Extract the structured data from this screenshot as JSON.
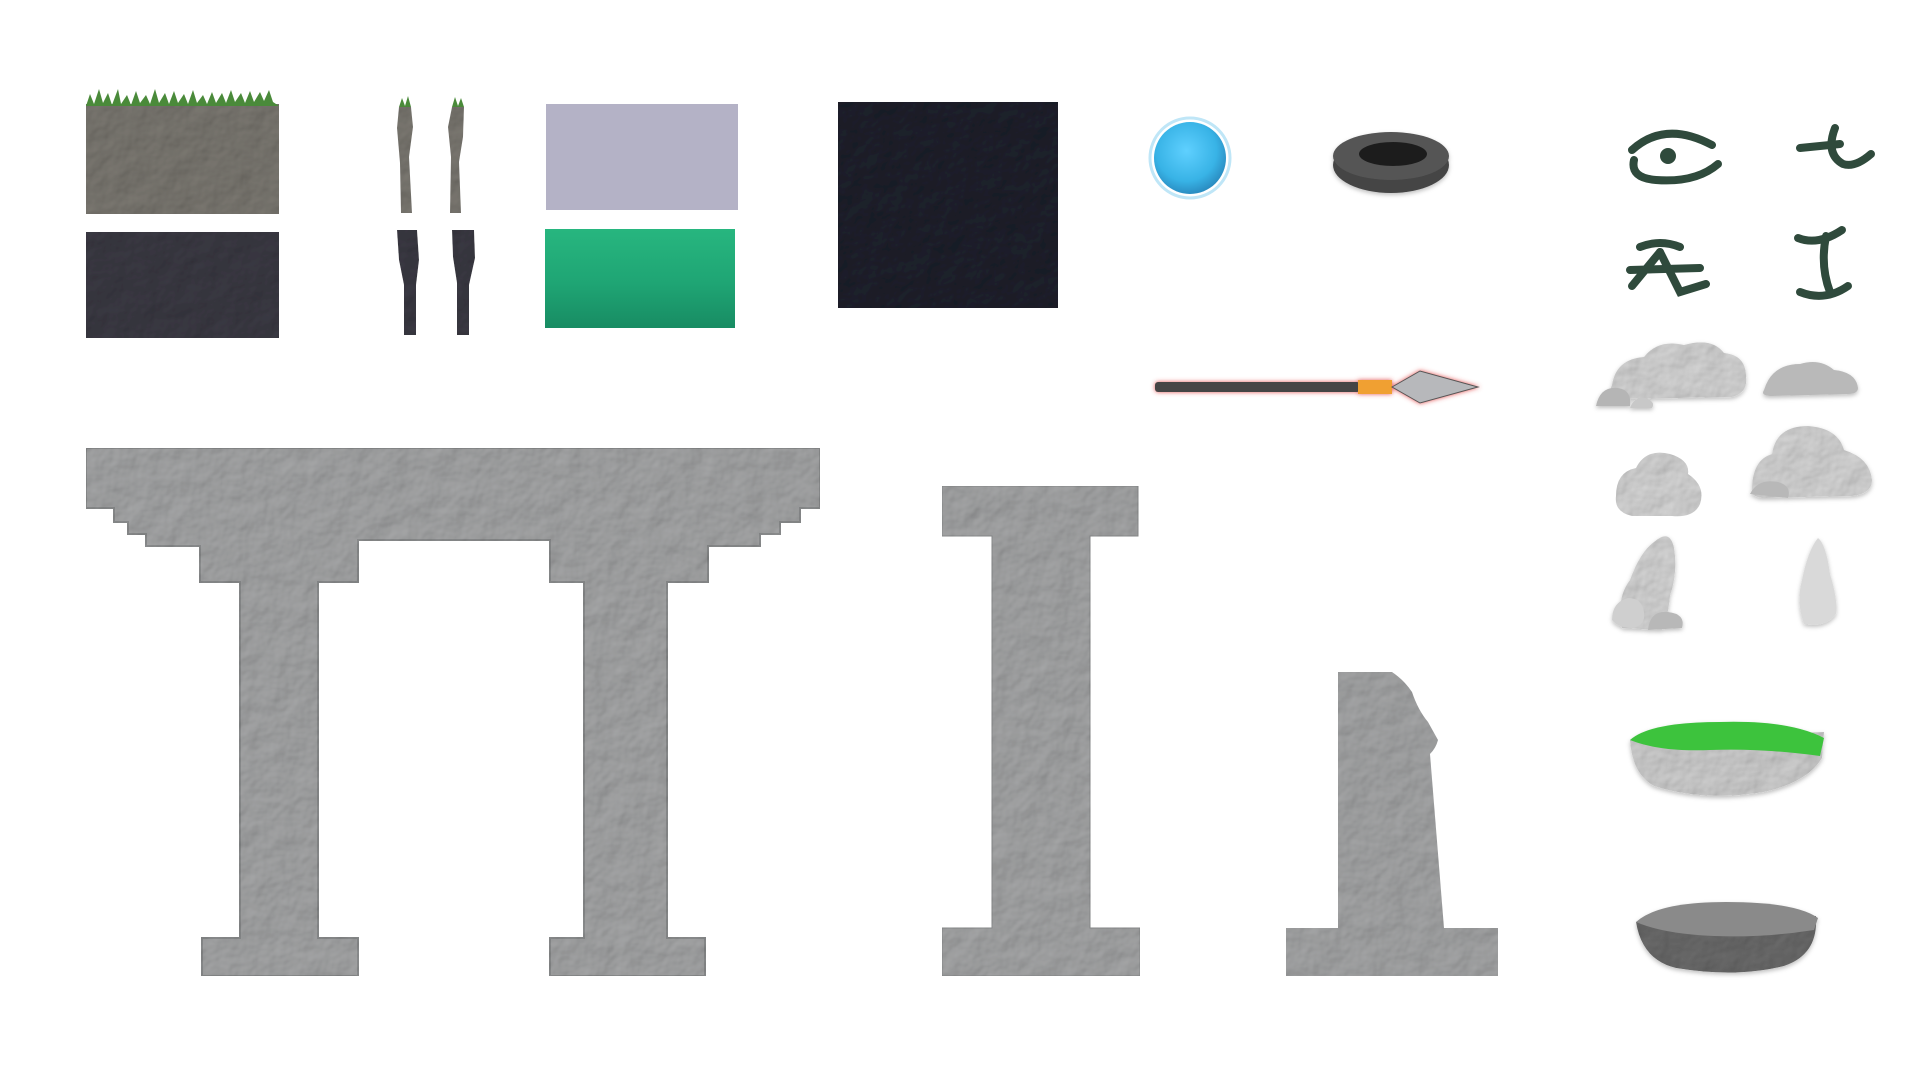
{
  "sprite_sheet": {
    "background_color": "#ffffff",
    "colors": {
      "stone_light": "#a8a9aa",
      "stone_edge": "#8f9192",
      "earth_gray": "#7d7a73",
      "earth_dark": "#3c3b45",
      "grass_green": "#4a8a3a",
      "lavender": "#b4b2c6",
      "jade_green": "#1fa574",
      "slate_black": "#1e222d",
      "water_blue": "#38b3e6",
      "spear_shaft": "#444444",
      "spear_band": "#f0a030",
      "spear_glow": "#e04040",
      "rock_white": "#d9d9d9",
      "rune_green": "#2f4a3c",
      "moss_green": "#3cc33c"
    },
    "tiles": [
      {
        "kind": "grass-topped-earth-tile"
      },
      {
        "kind": "dark-earth-tile"
      },
      {
        "kind": "narrow-earth-column-pair-light"
      },
      {
        "kind": "narrow-earth-column-pair-dark"
      },
      {
        "kind": "lavender-swatch"
      },
      {
        "kind": "jade-swatch"
      },
      {
        "kind": "slate-swatch"
      }
    ],
    "items": [
      {
        "kind": "water-orb"
      },
      {
        "kind": "stone-well-ring"
      },
      {
        "kind": "spear"
      }
    ],
    "runes": [
      {
        "kind": "eye-rune"
      },
      {
        "kind": "hook-rune"
      },
      {
        "kind": "figure-rune"
      },
      {
        "kind": "pillar-rune"
      }
    ],
    "rocks": [
      {
        "kind": "rock-cluster-large"
      },
      {
        "kind": "rock-flat"
      },
      {
        "kind": "rock-round"
      },
      {
        "kind": "rock-mound"
      },
      {
        "kind": "rock-spire-cluster"
      },
      {
        "kind": "rock-spire"
      }
    ],
    "structures": [
      {
        "kind": "stone-gate-double-arch"
      },
      {
        "kind": "stone-i-column"
      },
      {
        "kind": "broken-stone-column"
      }
    ],
    "platforms": [
      {
        "kind": "mossy-floating-platform"
      },
      {
        "kind": "gray-stone-basin"
      }
    ]
  }
}
